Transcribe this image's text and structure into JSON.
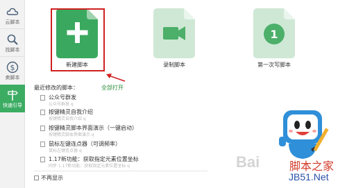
{
  "sidebar": {
    "items": [
      {
        "label": "云脚本",
        "icon": "cloud-icon"
      },
      {
        "label": "找脚本",
        "icon": "search-icon"
      },
      {
        "label": "卖脚本",
        "icon": "dollar-icon"
      },
      {
        "label": "快速引导",
        "icon": "signpost-icon",
        "active": true
      }
    ]
  },
  "tiles": [
    {
      "label": "新建脚本",
      "icon": "plus-icon"
    },
    {
      "label": "录制脚本",
      "icon": "video-camera-icon"
    },
    {
      "label": "第一次写脚本",
      "icon": "number-one-icon",
      "badge": "1"
    }
  ],
  "recent": {
    "title": "最近修改的脚本：",
    "open_all": "全部打开",
    "items": [
      {
        "title": "公众号群发",
        "subtitle": "公众号群发 q"
      },
      {
        "title": "按键精灵自我介绍",
        "subtitle": "按键精灵自我介绍 q"
      },
      {
        "title": "按键精灵脚本界面演示（一键启动）",
        "subtitle": "按键精灵脚本界面演示 q"
      },
      {
        "title": "鼠标左键连点器（可调频率）",
        "subtitle": "鼠标左键连点器 q"
      },
      {
        "title": "1.17新功能：获取指定元素位置坐标",
        "subtitle": "同步 1.17新功能：获取指定元素位置坐标 q"
      }
    ],
    "no_more_label": "不再显示"
  },
  "watermark": {
    "brand": "Bai",
    "cn_text": "脚本之家",
    "site": "JB51.Net"
  },
  "colors": {
    "accent_green": "#3cac63",
    "tile_light_green": "#cfe8d5",
    "highlight_red": "#d02020"
  }
}
